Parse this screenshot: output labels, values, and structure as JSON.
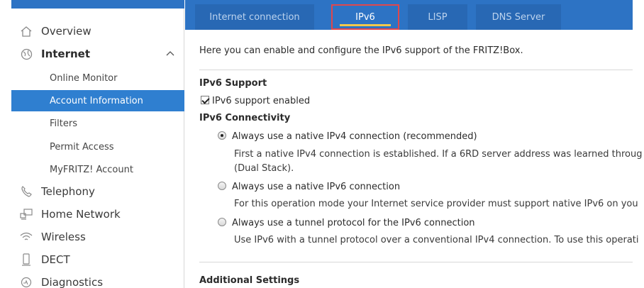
{
  "colors": {
    "accent": "#2d73c4",
    "active_nav": "#2f7fd0",
    "tab_highlight": "#e0474c"
  },
  "sidebar": {
    "items": [
      {
        "label": "Overview",
        "icon": "home-icon"
      },
      {
        "label": "Internet",
        "icon": "globe-icon",
        "expanded": true
      },
      {
        "label": "Online Monitor"
      },
      {
        "label": "Account Information",
        "active": true
      },
      {
        "label": "Filters"
      },
      {
        "label": "Permit Access"
      },
      {
        "label": "MyFRITZ! Account"
      },
      {
        "label": "Telephony",
        "icon": "phone-icon"
      },
      {
        "label": "Home Network",
        "icon": "network-icon"
      },
      {
        "label": "Wireless",
        "icon": "wifi-icon"
      },
      {
        "label": "DECT",
        "icon": "dect-icon"
      },
      {
        "label": "Diagnostics",
        "icon": "diagnostics-icon"
      }
    ]
  },
  "tabs": [
    {
      "label": "Internet connection"
    },
    {
      "label": "IPv6",
      "active": true
    },
    {
      "label": "LISP"
    },
    {
      "label": "DNS Server"
    }
  ],
  "main": {
    "intro": "Here you can enable and configure the IPv6 support of the FRITZ!Box.",
    "ipv6_support": {
      "heading": "IPv6 Support",
      "checkbox_label": "IPv6 support enabled",
      "checked": true
    },
    "connectivity": {
      "heading": "IPv6 Connectivity",
      "options": [
        {
          "label": "Always use a native IPv4 connection (recommended)",
          "selected": true,
          "desc": "First a native IPv4 connection is established. If a 6RD server address was learned throug",
          "desc2": "(Dual Stack)."
        },
        {
          "label": "Always use a native IPv6 connection",
          "selected": false,
          "desc": "For this operation mode your Internet service provider must support native IPv6 on you"
        },
        {
          "label": "Always use a tunnel protocol for the IPv6 connection",
          "selected": false,
          "desc": "Use IPv6 with a tunnel protocol over a conventional IPv4 connection. To use this operati"
        }
      ]
    },
    "additional_heading": "Additional Settings"
  }
}
